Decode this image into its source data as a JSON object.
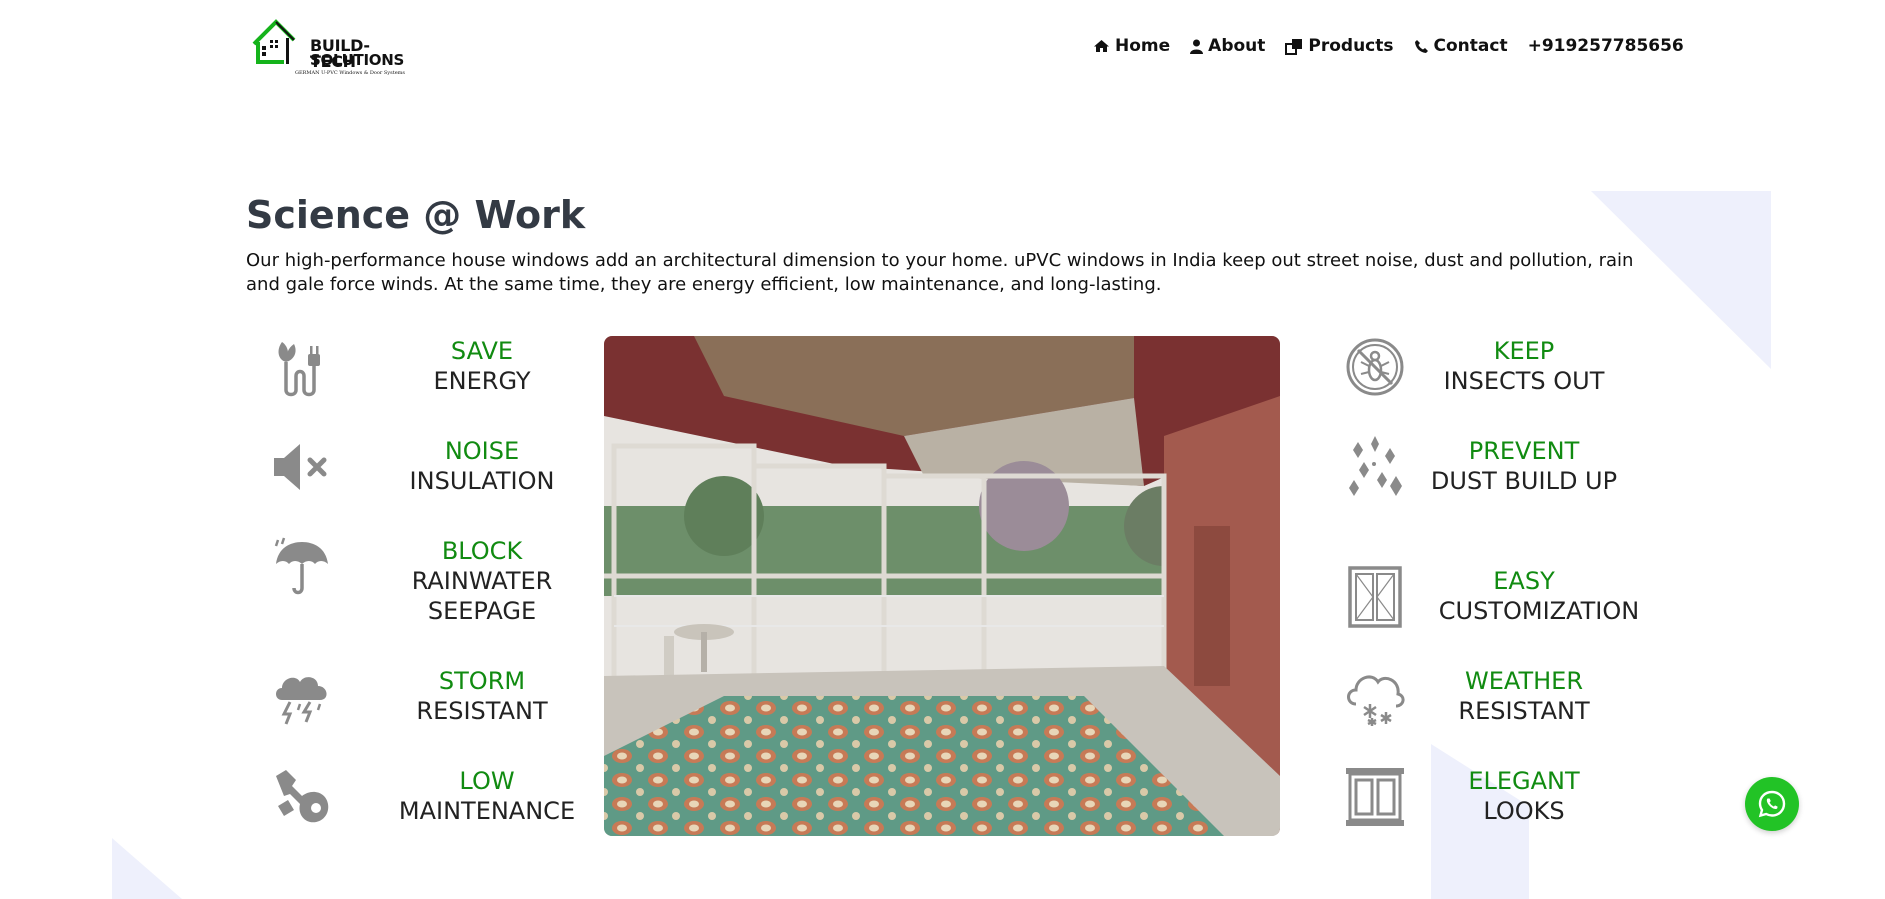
{
  "brand": {
    "name_line1": "BUILD-TECH",
    "name_line2": "SOLUTIONS",
    "tagline": "GERMAN U-PVC Windows & Door Systems"
  },
  "nav": {
    "items": [
      {
        "label": "Home",
        "icon": "home-icon"
      },
      {
        "label": "About",
        "icon": "user-icon"
      },
      {
        "label": "Products",
        "icon": "clone-icon"
      },
      {
        "label": "Contact",
        "icon": "phone-icon"
      }
    ],
    "phone": "+919257785656"
  },
  "section": {
    "title": "Science @ Work",
    "intro": "Our high-performance house windows add an architectural dimension to your home. uPVC windows in India keep out street noise, dust and pollution, rain and gale force winds. At the same time, they are energy efficient, low maintenance, and long-lasting."
  },
  "features_left": [
    {
      "highlight": "SAVE",
      "text": "ENERGY",
      "icon": "plant-plug-icon"
    },
    {
      "highlight": "NOISE",
      "text": "INSULATION",
      "icon": "mute-speaker-icon"
    },
    {
      "highlight": "BLOCK",
      "text": "RAINWATER SEEPAGE",
      "icon": "umbrella-rain-icon"
    },
    {
      "highlight": "STORM",
      "text": "RESISTANT",
      "icon": "storm-cloud-icon"
    },
    {
      "highlight": "LOW",
      "text": "MAINTENANCE",
      "icon": "tools-icon"
    }
  ],
  "features_right": [
    {
      "highlight": "KEEP",
      "text": "INSECTS OUT",
      "icon": "no-insect-icon"
    },
    {
      "highlight": "PREVENT",
      "text": "DUST BUILD UP",
      "icon": "sparkles-icon"
    },
    {
      "highlight": "EASY",
      "text": "CUSTOMIZATION",
      "icon": "window-frame-icon"
    },
    {
      "highlight": "WEATHER",
      "text": "RESISTANT",
      "icon": "snow-cloud-icon"
    },
    {
      "highlight": "ELEGANT",
      "text": "LOOKS",
      "icon": "double-window-icon"
    }
  ],
  "colors": {
    "accent_green": "#118b11",
    "whatsapp_green": "#22c326",
    "title_color": "#333a44",
    "deco_lavender": "#eef0fc"
  }
}
